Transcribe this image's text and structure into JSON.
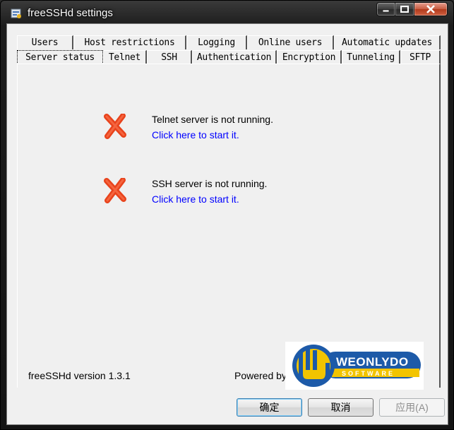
{
  "window": {
    "title": "freeSSHd settings"
  },
  "tabs": {
    "back_row": [
      "Users",
      "Host restrictions",
      "Logging",
      "Online users",
      "Automatic updates"
    ],
    "front_row": [
      "Server status",
      "Telnet",
      "SSH",
      "Authentication",
      "Encryption",
      "Tunneling",
      "SFTP"
    ],
    "active": "Server status"
  },
  "status": {
    "telnet_text": "Telnet server is not running.",
    "telnet_link": "Click here to start it.",
    "ssh_text": "SSH server is not running.",
    "ssh_link": "Click here to start it."
  },
  "footer": {
    "version": "freeSSHd version 1.3.1",
    "powered_by": "Powered by",
    "logo_name": "WEONLYDO",
    "logo_sub": "SOFTWARE"
  },
  "buttons": {
    "ok": "确定",
    "cancel": "取消",
    "apply": "应用(A)"
  },
  "colors": {
    "link": "#0000ff",
    "error_icon": "#e8431c",
    "logo_blue": "#1d5aa8",
    "logo_yellow": "#f2c400"
  }
}
